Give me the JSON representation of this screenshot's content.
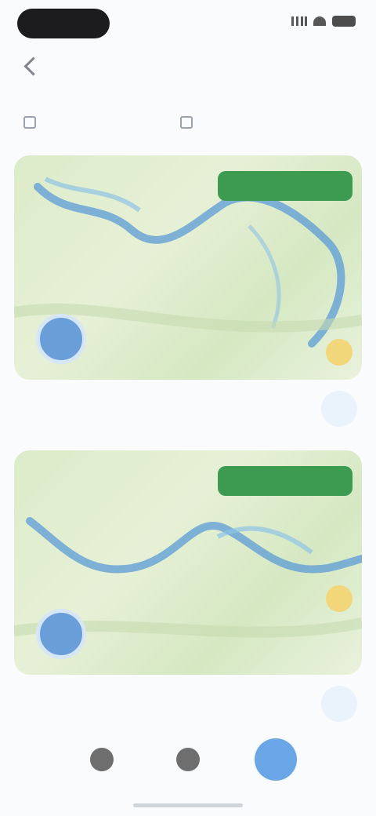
{
  "status_bar": {
    "icons": [
      "signal-icon",
      "wifi-icon",
      "battery-icon"
    ]
  },
  "nav": {
    "title": "",
    "action_label": "",
    "icons": [
      "chevron-left-icon"
    ]
  },
  "tabs": [
    {
      "label": "",
      "active": false
    },
    {
      "label": "",
      "active": false
    },
    {
      "label": "",
      "active": true
    }
  ],
  "cards": [
    {
      "banner_label": "",
      "place_labels": [
        "",
        ""
      ],
      "title": "",
      "meta": "",
      "badge": ""
    },
    {
      "banner_label": "",
      "place_labels": [
        "",
        ""
      ],
      "title": "",
      "meta": "",
      "badge": ""
    }
  ],
  "bottom_bar": {
    "icons": [
      "record-icon",
      "camera-icon",
      "location-icon"
    ]
  },
  "colors": {
    "accent": "#2f80ed",
    "map_banner": "#3c9a51",
    "map_bg": "#dcebc9",
    "river": "#5b9bd5"
  }
}
